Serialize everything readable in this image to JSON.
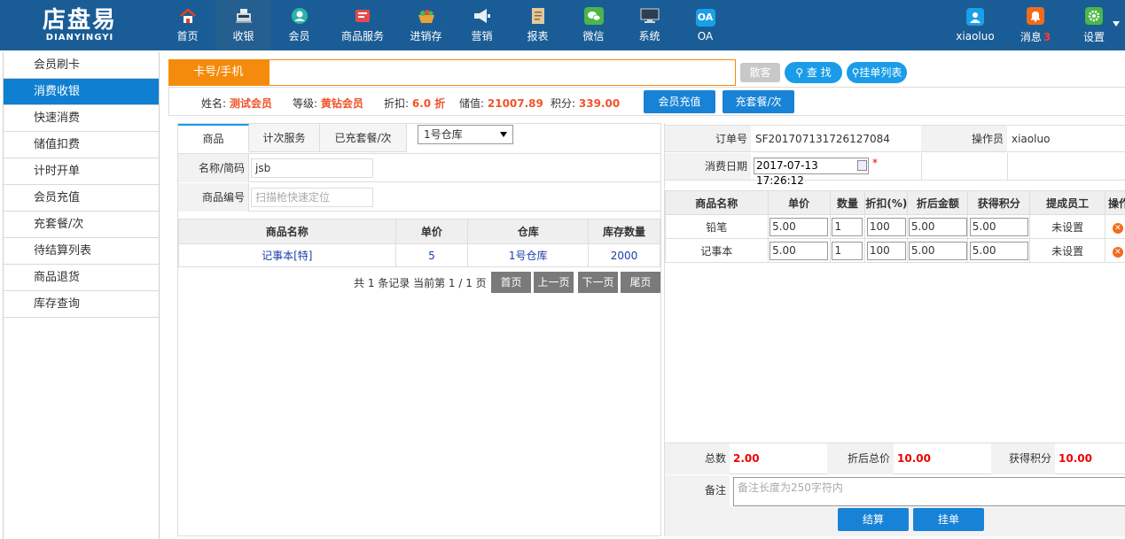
{
  "brand": {
    "name_cn": "店盘易",
    "name_en": "DIANYINGYI"
  },
  "nav": [
    {
      "label": "首页",
      "icon": "home-icon",
      "color": "#e8401c"
    },
    {
      "label": "收银",
      "icon": "cash-register-icon",
      "color": "#cfd8df"
    },
    {
      "label": "会员",
      "icon": "member-icon",
      "color": "#2cb3a8"
    },
    {
      "label": "商品服务",
      "icon": "product-service-icon",
      "color": "#e34b4b"
    },
    {
      "label": "进销存",
      "icon": "inventory-icon",
      "color": "#e9a23b"
    },
    {
      "label": "营销",
      "icon": "megaphone-icon",
      "color": "#e7eef5"
    },
    {
      "label": "报表",
      "icon": "report-icon",
      "color": "#e3c89b"
    },
    {
      "label": "微信",
      "icon": "wechat-icon",
      "color": "#4cb748"
    },
    {
      "label": "系统",
      "icon": "monitor-icon",
      "color": "#2c3e50"
    },
    {
      "label": "OA",
      "icon": "oa-icon",
      "color": "#1aa0e6",
      "glyph": "OA"
    }
  ],
  "user": {
    "name": "xiaoluo",
    "messages_label": "消息",
    "messages_count": "3",
    "settings_label": "设置"
  },
  "sidebar": [
    "会员刷卡",
    "消费收银",
    "快速消费",
    "储值扣费",
    "计时开单",
    "会员充值",
    "充套餐/次",
    "待结算列表",
    "商品退货",
    "库存查询"
  ],
  "card_search": {
    "label": "卡号/手机",
    "guest_btn": "散客",
    "search_btn": "查 找",
    "hang_list_btn": "挂单列表"
  },
  "member": {
    "name_label": "姓名:",
    "name": "测试会员",
    "level_label": "等级:",
    "level": "黄钻会员",
    "discount_label": "折扣:",
    "discount": "6.0 折",
    "balance_label": "储值:",
    "balance": "21007.89",
    "points_label": "积分:",
    "points": "339.00",
    "recharge_btn": "会员充值",
    "package_btn": "充套餐/次"
  },
  "left": {
    "tabs": [
      "商品",
      "计次服务",
      "已充套餐/次"
    ],
    "warehouse": "1号仓库",
    "filter": {
      "name_label": "名称/简码",
      "name_value": "jsb",
      "code_label": "商品编号",
      "code_placeholder": "扫描枪快速定位"
    },
    "table": {
      "headers": [
        "商品名称",
        "单价",
        "仓库",
        "库存数量"
      ],
      "rows": [
        {
          "name": "记事本[特]",
          "price": "5",
          "warehouse": "1号仓库",
          "stock": "2000"
        }
      ]
    },
    "pager": {
      "summary": "共 1 条记录 当前第 1 / 1 页",
      "first": "首页",
      "prev": "上一页",
      "next": "下一页",
      "last": "尾页"
    }
  },
  "right": {
    "order_no_label": "订单号",
    "order_no": "SF201707131726127084",
    "operator_label": "操作员",
    "operator": "xiaoluo",
    "date_label": "消费日期",
    "date": "2017-07-13 17:26:12",
    "cart": {
      "headers": [
        "商品名称",
        "单价",
        "数量",
        "折扣(%)",
        "折后金额",
        "获得积分",
        "提成员工",
        "操作"
      ],
      "rows": [
        {
          "name": "铅笔",
          "price": "5.00",
          "qty": "1",
          "discount": "100",
          "amount": "5.00",
          "points": "5.00",
          "staff": "未设置"
        },
        {
          "name": "记事本",
          "price": "5.00",
          "qty": "1",
          "discount": "100",
          "amount": "5.00",
          "points": "5.00",
          "staff": "未设置"
        }
      ]
    },
    "summary": {
      "total_label": "总数",
      "total": "2.00",
      "after_discount_label": "折后总价",
      "after_discount": "10.00",
      "points_label": "获得积分",
      "points": "10.00",
      "note_label": "备注",
      "note_placeholder": "备注长度为250字符内"
    },
    "settle_btn": "结算",
    "hang_btn": "挂单"
  },
  "colors": {
    "topbar": "#1a5d96",
    "accent_orange": "#f58b0c",
    "accent_blue": "#1883d6",
    "value_red": "#e00000"
  }
}
